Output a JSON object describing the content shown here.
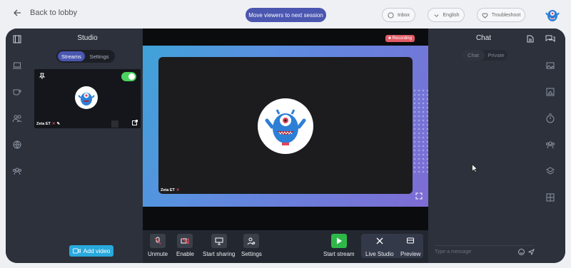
{
  "topbar": {
    "back_label": "Back to lobby",
    "move_label": "Move viewers to next session",
    "inbox_label": "Inbox",
    "language_label": "English",
    "troubleshoot_label": "Troubleshoot"
  },
  "studio": {
    "title": "Studio",
    "tabs": [
      "Streams",
      "Settings"
    ],
    "stream_name": "Zeta ET",
    "add_video_label": "Add video"
  },
  "stage": {
    "recording_label": "Recording",
    "speaker_name": "Zeta ET"
  },
  "controls": {
    "unmute": "Unmute",
    "enable": "Enable",
    "start_sharing": "Start sharing",
    "settings": "Settings",
    "start_stream": "Start stream",
    "live_studio": "Live Studio",
    "preview": "Preview"
  },
  "chat": {
    "title": "Chat",
    "tabs": [
      "Chat",
      "Private"
    ],
    "placeholder": "Type a message"
  },
  "colors": {
    "accent": "#4a56b0",
    "live_green": "#2fb84a",
    "add_video_blue": "#29a9dc",
    "recording_red": "#e05a64"
  }
}
